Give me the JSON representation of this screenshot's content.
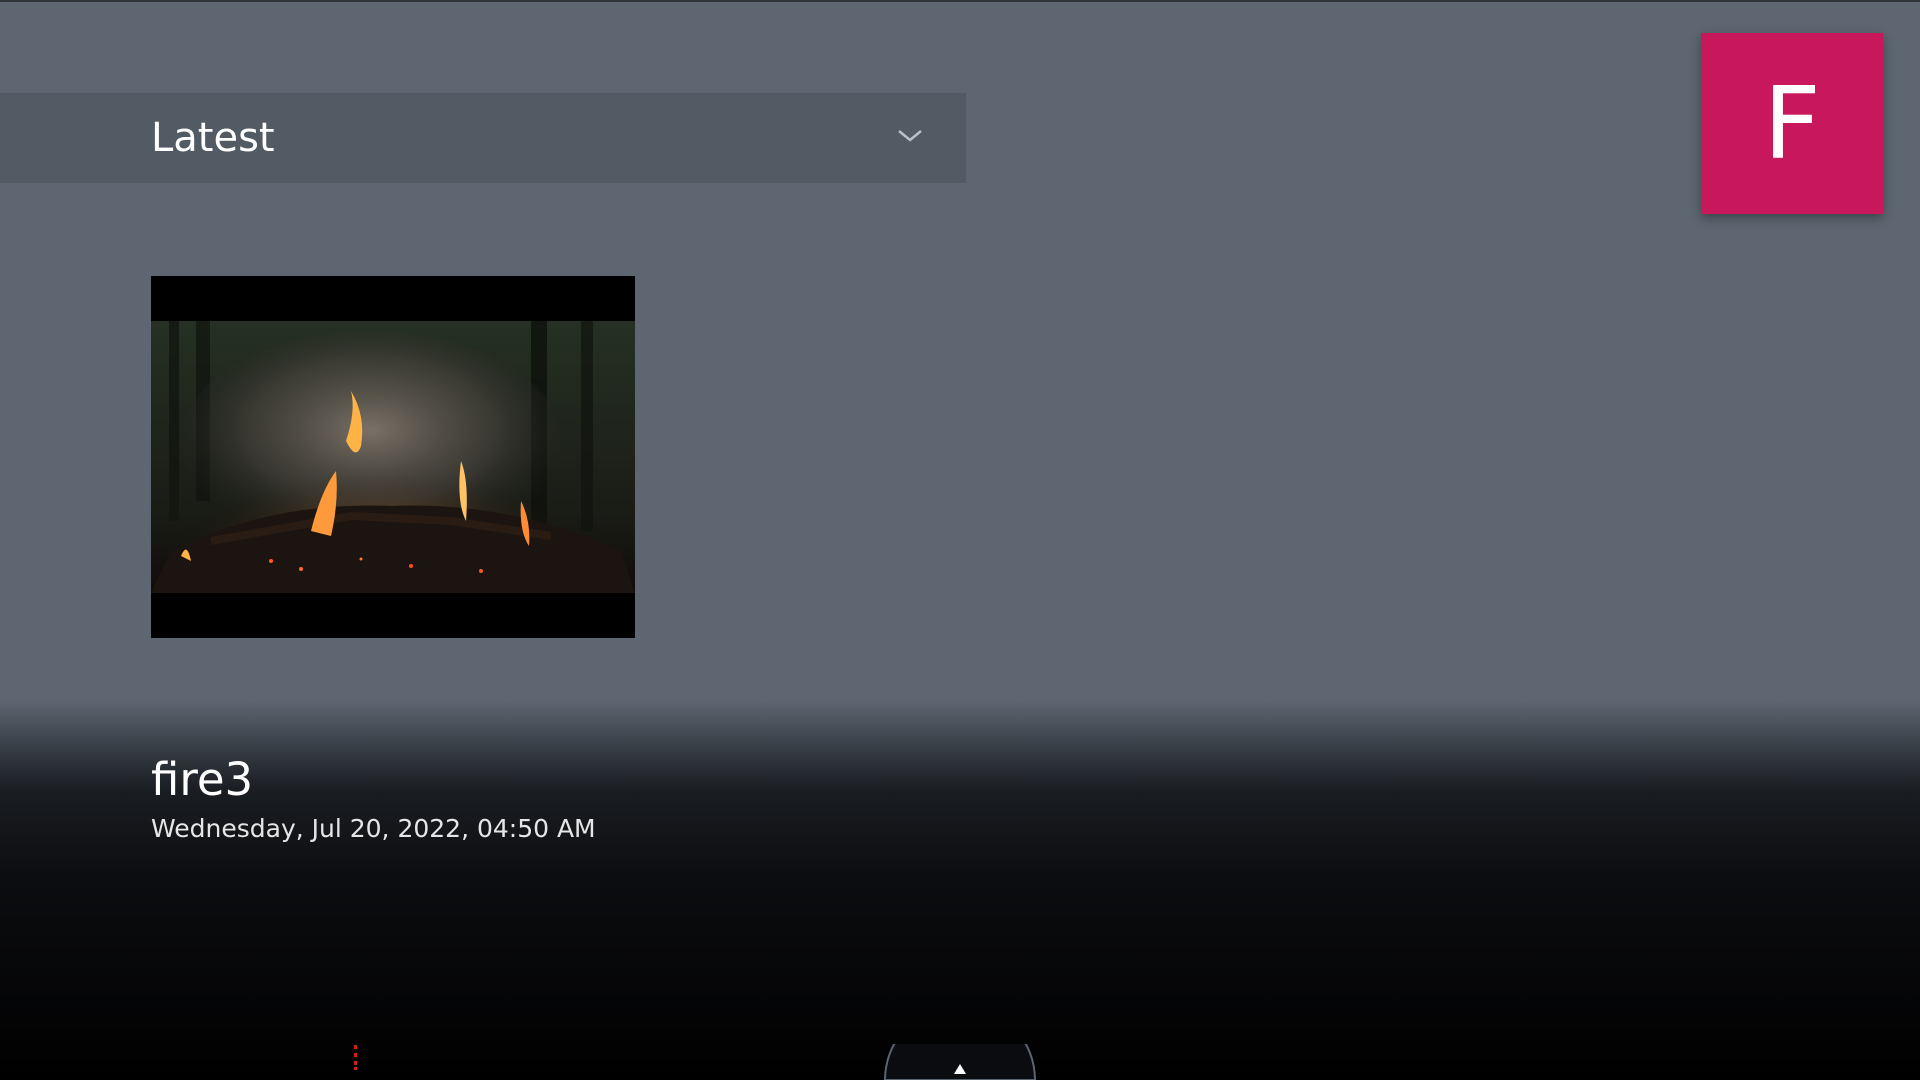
{
  "filter": {
    "selected": "Latest",
    "icon": "chevron-down-icon"
  },
  "profile": {
    "initial": "F",
    "color": "#c8175a"
  },
  "video": {
    "title": "fire3",
    "date": "Wednesday, Jul 20, 2022, 04:50 AM"
  },
  "bottom_bar": {
    "icon": "up-arrow-icon"
  },
  "colors": {
    "background": "#5d6671",
    "dropdown_bg": "#525b64",
    "profile_tile": "#c8175a",
    "indicator_red": "#d0201a"
  }
}
